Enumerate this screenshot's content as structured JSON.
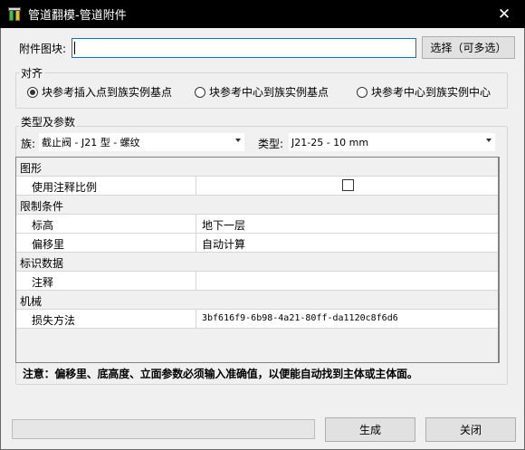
{
  "window": {
    "title": "管道翻模-管道附件",
    "close_glyph": "✕",
    "app_icon": "app-icon"
  },
  "attachment": {
    "label": "附件图块:",
    "value": "",
    "select_button": "选择（可多选）"
  },
  "align": {
    "title": "对齐",
    "options": [
      {
        "label": "块参考插入点到族实例基点",
        "selected": true
      },
      {
        "label": "块参考中心到族实例基点",
        "selected": false
      },
      {
        "label": "块参考中心到族实例中心",
        "selected": false
      }
    ]
  },
  "typeparams": {
    "title": "类型及参数",
    "family_label": "族:",
    "family_value": "截止阀 - J21 型 - 螺纹",
    "type_label": "类型:",
    "type_value": "J21-25 - 10 mm"
  },
  "properties": {
    "cat_graphics": "图形",
    "use_annotation_scale": "使用注释比例",
    "use_annotation_scale_checked": false,
    "cat_constraints": "限制条件",
    "level_name": "标高",
    "level_value": "地下一层",
    "offset_name": "偏移里",
    "offset_value": "自动计算",
    "cat_identity": "标识数据",
    "comment_name": "注释",
    "comment_value": "",
    "cat_mechanical": "机械",
    "loss_name": "损失方法",
    "loss_value": "3bf616f9-6b98-4a21-80ff-da1120c8f6d6"
  },
  "note": "注意：偏移里、底高度、立面参数必须输入准确值，以便能自动找到主体或主体面。",
  "progress": {
    "percent": 0
  },
  "footer": {
    "generate": "生成",
    "close": "关闭"
  }
}
